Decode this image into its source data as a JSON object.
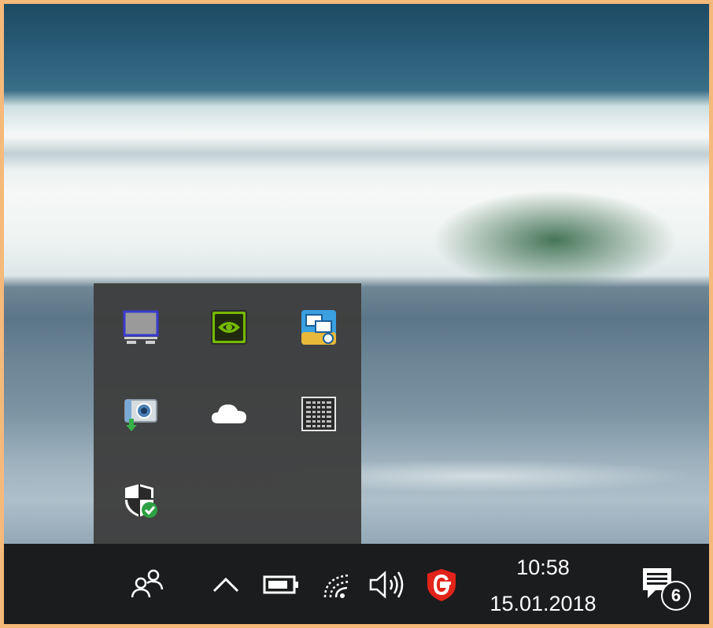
{
  "tray_overflow": {
    "icons": [
      {
        "name": "display-settings-icon"
      },
      {
        "name": "nvidia-icon"
      },
      {
        "name": "network-monitor-icon"
      },
      {
        "name": "photo-import-icon"
      },
      {
        "name": "onedrive-cloud-icon"
      },
      {
        "name": "keyboard-panel-icon"
      },
      {
        "name": "windows-defender-icon"
      }
    ]
  },
  "taskbar": {
    "people_icon": "people-icon",
    "show_hidden_icon": "chevron-up-icon",
    "battery_icon": "battery-icon",
    "wifi_icon": "wifi-icon",
    "volume_icon": "speaker-icon",
    "gdata_icon": "gdata-shield-icon",
    "clock": {
      "time": "10:58",
      "date": "15.01.2018"
    },
    "action_center": {
      "icon": "notification-icon",
      "count": "6"
    }
  },
  "colors": {
    "taskbar_bg": "#1b1c1e",
    "flyout_bg": "#3e3e3e",
    "gdata_red": "#e2231a",
    "nvidia_green": "#76b900",
    "defender_green": "#2ea043"
  }
}
